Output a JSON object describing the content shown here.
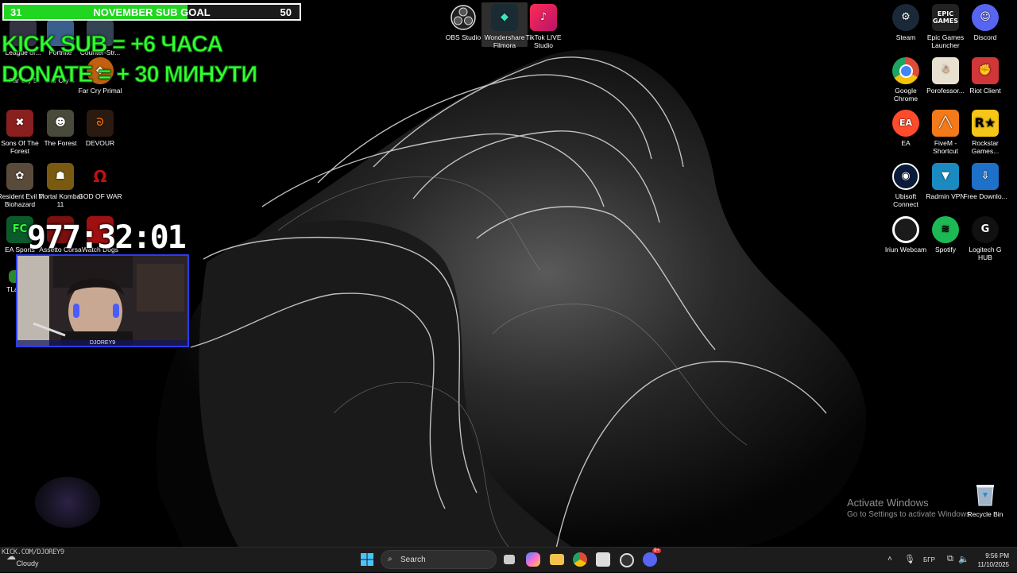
{
  "goal": {
    "current": "31",
    "title": "NOVEMBER SUB GOAL",
    "target": "50",
    "fill_fraction": 0.62
  },
  "promo": {
    "line1": "KICK SUB = +6 ЧАСА",
    "line2": "DONATE = + 30 МИНУТИ"
  },
  "timer": "977:32:01",
  "webcam": {
    "name": "DJOREY9"
  },
  "top_apps": [
    {
      "label": "OBS Studio",
      "icon": "obs-icon",
      "color": "#1f1f1f"
    },
    {
      "label": "Wondershare Filmora",
      "icon": "filmora-icon",
      "color": "#1b2b33"
    },
    {
      "label": "TikTok LIVE Studio",
      "icon": "tiktok-icon",
      "color": "#ff2c55"
    }
  ],
  "left_icons": [
    {
      "label": "League of...",
      "icon": "game-icon",
      "color": "#334"
    },
    {
      "label": "Fortnite",
      "icon": "fortnite-icon",
      "color": "#3a5f8c"
    },
    {
      "label": "Counter-Str...",
      "icon": "cs-icon",
      "color": "#345"
    },
    {
      "label": "Far Cry 5",
      "icon": "farcry-icon",
      "color": "#553"
    },
    {
      "label": "Far Cry 4",
      "icon": "farcry-icon",
      "color": "#544"
    },
    {
      "label": "Far Cry Primal",
      "icon": "farcry-primal-icon",
      "color": "#c06010"
    },
    {
      "label": "Sons Of The Forest",
      "icon": "sons-forest-icon",
      "color": "#8a1f1f"
    },
    {
      "label": "The Forest",
      "icon": "the-forest-icon",
      "color": "#4a4a3a"
    },
    {
      "label": "DEVOUR",
      "icon": "devour-icon",
      "color": "#2a1a10"
    },
    {
      "label": "Resident Evil 7 Biohazard",
      "icon": "re7-icon",
      "color": "#5a4a3a"
    },
    {
      "label": "Mortal Kombat 11",
      "icon": "mk11-icon",
      "color": "#7a5a10"
    },
    {
      "label": "GOD OF WAR",
      "icon": "gow-icon",
      "color": "#000000"
    },
    {
      "label": "EA Sports",
      "icon": "ea-sports-icon",
      "color": "#0a5a2a"
    },
    {
      "label": "Assetto Corsa",
      "icon": "assetto-icon",
      "color": "#7a1010"
    },
    {
      "label": "Watch Dogs",
      "icon": "watchdogs-icon",
      "color": "#a01010"
    },
    {
      "label": "TLa...",
      "icon": "tlauncher-icon",
      "color": "#2a8a2a"
    }
  ],
  "right_icons": [
    {
      "label": "Steam",
      "icon": "steam-icon",
      "color": "#1b2838"
    },
    {
      "label": "Epic Games Launcher",
      "icon": "epic-icon",
      "color": "#222222"
    },
    {
      "label": "Discord",
      "icon": "discord-icon",
      "color": "#5865f2"
    },
    {
      "label": "Google Chrome",
      "icon": "chrome-icon",
      "color": "#dd4b39"
    },
    {
      "label": "Porofessor...",
      "icon": "porofessor-icon",
      "color": "#e8e0d0"
    },
    {
      "label": "Riot Client",
      "icon": "riot-icon",
      "color": "#d13639"
    },
    {
      "label": "EA",
      "icon": "ea-icon",
      "color": "#ff4b2b"
    },
    {
      "label": "FiveM - Shortcut",
      "icon": "fivem-icon",
      "color": "#f27a1a"
    },
    {
      "label": "Rockstar Games...",
      "icon": "rockstar-icon",
      "color": "#f5c518"
    },
    {
      "label": "Ubisoft Connect",
      "icon": "ubisoft-icon",
      "color": "#0a1a3a"
    },
    {
      "label": "Radmin VPN",
      "icon": "radmin-icon",
      "color": "#1a8ac0"
    },
    {
      "label": "Free Downlo...",
      "icon": "download-icon",
      "color": "#1e70c8"
    },
    {
      "label": "Iriun Webcam",
      "icon": "iriun-icon",
      "color": "#1a1a1a"
    },
    {
      "label": "Spotify",
      "icon": "spotify-icon",
      "color": "#1db954"
    },
    {
      "label": "Logitech G HUB",
      "icon": "logitech-icon",
      "color": "#111111"
    }
  ],
  "recycle_bin": {
    "label": "Recycle Bin",
    "icon": "recycle-bin-icon"
  },
  "activate": {
    "title": "Activate Windows",
    "subtitle": "Go to Settings to activate Windows."
  },
  "taskbar": {
    "weather": "Cloudy",
    "search_placeholder": "Search",
    "language": "БГР",
    "time": "9:56 PM",
    "date": "11/10/2025",
    "discord_badge": "9+"
  },
  "streamer_tag": "KICK.COM/DJOREY9"
}
